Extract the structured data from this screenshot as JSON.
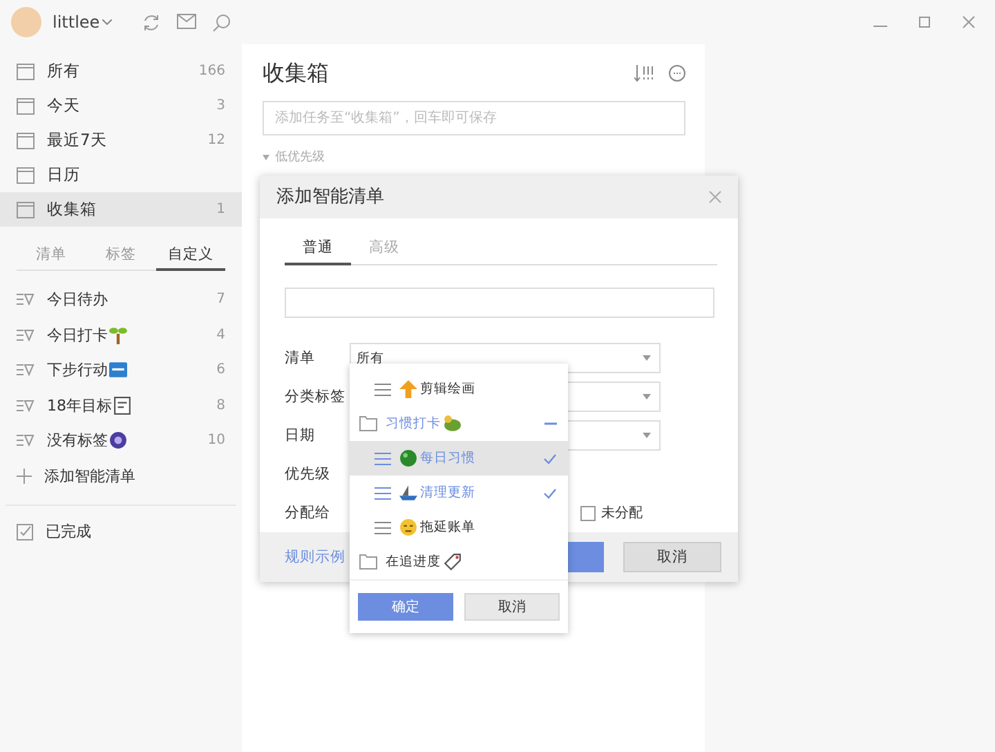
{
  "window": {
    "user": "littlee"
  },
  "nav": [
    {
      "label": "所有",
      "count": "166",
      "selected": false
    },
    {
      "label": "今天",
      "count": "3",
      "selected": false
    },
    {
      "label": "最近7天",
      "count": "12",
      "selected": false
    },
    {
      "label": "日历",
      "selected": false
    },
    {
      "label": "收集箱",
      "count": "1",
      "selected": true
    }
  ],
  "list_tabs": [
    {
      "label": "清单",
      "selected": false
    },
    {
      "label": "标签",
      "selected": false
    },
    {
      "label": "自定义",
      "selected": true
    }
  ],
  "custom_lists": [
    {
      "label": "今日待办",
      "count": "7"
    },
    {
      "label": "今日打卡",
      "count": "4"
    },
    {
      "label": "下步行动",
      "count": "6"
    },
    {
      "label": "18年目标",
      "count": "8"
    },
    {
      "label": "没有标签",
      "count": "10"
    }
  ],
  "add_list": "添加智能清单",
  "completed": "已完成",
  "main": {
    "title": "收集箱",
    "add_task": {
      "placeholder": "添加任务至“收集箱”，回车即可保存"
    },
    "group": "低优先级"
  },
  "dialog": {
    "title": "添加智能清单",
    "tabs": [
      {
        "label": "普通",
        "selected": true
      },
      {
        "label": "高级",
        "selected": false
      }
    ],
    "fields": [
      {
        "label": "清单",
        "kind": "select",
        "value": "所有"
      },
      {
        "label": "分类标签",
        "kind": "select"
      },
      {
        "label": "日期",
        "kind": "select"
      },
      {
        "label": "优先级",
        "kind": "covered"
      },
      {
        "label": "分配给",
        "kind": "checkbox",
        "option": "未分配",
        "checked": false
      }
    ],
    "rules_link": "规则示例",
    "cancel": "取消"
  },
  "picker": {
    "items": [
      {
        "label": "剪辑绘画",
        "kind": "list",
        "checked": false,
        "selected": false
      },
      {
        "label": "习惯打卡",
        "kind": "folder",
        "expanded": true,
        "children": [
          {
            "label": "每日习惯",
            "kind": "list",
            "checked": true,
            "selected": true
          },
          {
            "label": "清理更新",
            "kind": "list",
            "checked": true,
            "selected": false
          }
        ]
      },
      {
        "label": "拖延账单",
        "kind": "list",
        "checked": false,
        "selected": false
      },
      {
        "label": "在追进度",
        "kind": "folder",
        "expanded": false
      }
    ],
    "buttons": [
      {
        "label": "确定",
        "kind": "primary"
      },
      {
        "label": "取消",
        "kind": "secondary"
      }
    ]
  }
}
